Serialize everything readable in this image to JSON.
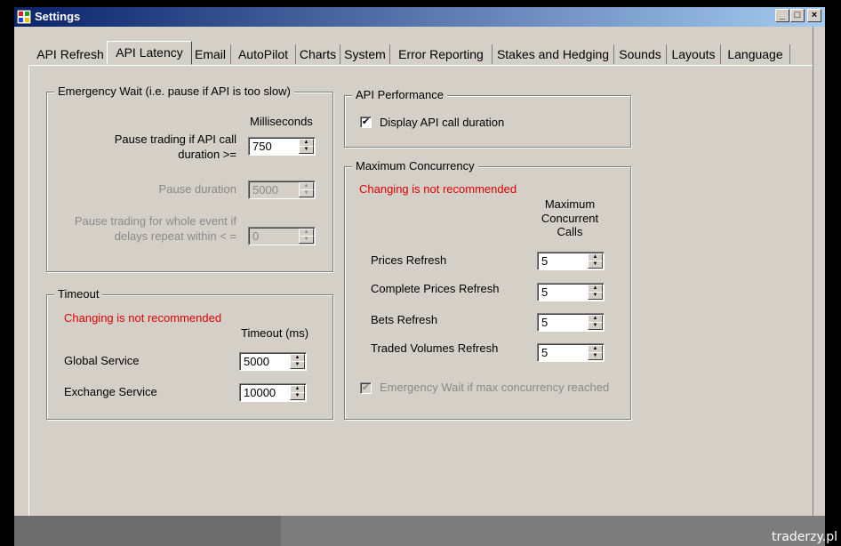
{
  "window": {
    "title": "Settings"
  },
  "tabs": [
    {
      "label": "API Refresh",
      "active": false
    },
    {
      "label": "API Latency",
      "active": true
    },
    {
      "label": "Email",
      "active": false
    },
    {
      "label": "AutoPilot",
      "active": false
    },
    {
      "label": "Charts",
      "active": false
    },
    {
      "label": "System",
      "active": false
    },
    {
      "label": "Error Reporting",
      "active": false
    },
    {
      "label": "Stakes and Hedging",
      "active": false
    },
    {
      "label": "Sounds",
      "active": false
    },
    {
      "label": "Layouts",
      "active": false
    },
    {
      "label": "Language",
      "active": false
    }
  ],
  "emergency": {
    "title": "Emergency Wait (i.e. pause if API is too slow)",
    "col_header": "Milliseconds",
    "pause_trading_label_1": "Pause trading if API call",
    "pause_trading_label_2": "duration >=",
    "pause_trading_value": "750",
    "pause_duration_label": "Pause duration",
    "pause_duration_value": "5000",
    "whole_event_label_1": "Pause trading for whole event if",
    "whole_event_label_2": "delays repeat within < =",
    "whole_event_value": "0"
  },
  "timeout": {
    "title": "Timeout",
    "warning": "Changing is not recommended",
    "col_header": "Timeout (ms)",
    "global_label": "Global Service",
    "global_value": "5000",
    "exchange_label": "Exchange Service",
    "exchange_value": "10000"
  },
  "api_performance": {
    "title": "API Performance",
    "display_label": "Display API call duration",
    "display_checked": true
  },
  "concurrency": {
    "title": "Maximum Concurrency",
    "warning": "Changing is not recommended",
    "col_header_1": "Maximum",
    "col_header_2": "Concurrent",
    "col_header_3": "Calls",
    "rows": [
      {
        "label": "Prices Refresh",
        "value": "5"
      },
      {
        "label": "Complete Prices Refresh",
        "value": "5"
      },
      {
        "label": "Bets Refresh",
        "value": "5"
      },
      {
        "label": "Traded Volumes Refresh",
        "value": "5"
      }
    ],
    "emergency_label": "Emergency Wait if max concurrency reached",
    "emergency_checked": true
  },
  "watermark": "traderzy.pl",
  "colors": {
    "title_start": "#0a246a",
    "title_end": "#a6caf0",
    "warning": "#e00000",
    "face": "#d4d0c8"
  }
}
